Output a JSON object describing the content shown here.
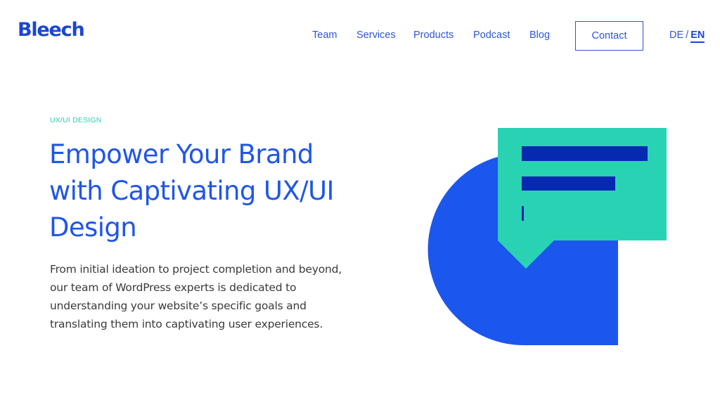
{
  "brand": {
    "logo_text": "Bleech"
  },
  "nav": {
    "items": [
      {
        "label": "Team"
      },
      {
        "label": "Services"
      },
      {
        "label": "Products"
      },
      {
        "label": "Podcast"
      },
      {
        "label": "Blog"
      }
    ],
    "contact_label": "Contact",
    "languages": {
      "de": "DE",
      "separator": "/",
      "en": "EN",
      "active": "EN"
    }
  },
  "hero": {
    "eyebrow": "UX/UI DESIGN",
    "headline_lines": [
      "Empower Your Brand",
      "with Captivating UX/UI",
      "Design"
    ],
    "body_lines": [
      "From initial ideation to project completion and beyond,",
      "our team of WordPress experts is dedicated to",
      "understanding your website’s specific goals and",
      "translating them into captivating user experiences."
    ]
  },
  "illustration": {
    "icon": "chat-bubble-over-shape-icon",
    "colors": {
      "shape_blue": "#1b57ec",
      "bubble_green": "#2ad2b4",
      "text_bars": "#0529b1"
    }
  },
  "colors": {
    "brand": "#1a47d0",
    "link": "#2f55d4",
    "headline": "#1f56e8",
    "eyebrow": "#2bcfb2",
    "body": "#3a3a3a"
  }
}
